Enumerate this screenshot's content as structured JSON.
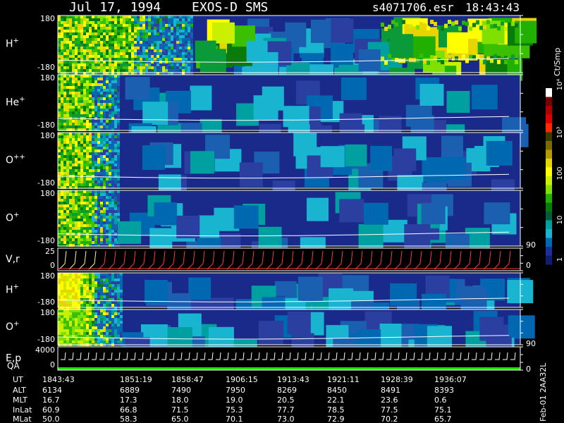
{
  "header": {
    "date": "Jul 17, 1994",
    "instrument": "EXOS-D SMS",
    "file": "s4071706.esr",
    "time": "18:43:43"
  },
  "side_label": "Feb-01 2AA32L",
  "colorbar": {
    "unit": "Ct/Smp",
    "ticks": [
      "1",
      "10",
      "100",
      "10³",
      "10⁴"
    ],
    "colors": [
      "#ffffff",
      "#7a0000",
      "#b00000",
      "#e00000",
      "#ff2a00",
      "#3b3b00",
      "#7a6b00",
      "#b89a00",
      "#e8d400",
      "#ffff00",
      "#c8f000",
      "#80e000",
      "#22b000",
      "#0a7a0a",
      "#005f3a",
      "#00a0a0",
      "#18b4d0",
      "#0068b0",
      "#1a2f9a",
      "#101c70"
    ]
  },
  "panels": [
    {
      "label_base": "H",
      "label_sup": "+",
      "ymax": "180",
      "ymin": "-180"
    },
    {
      "label_base": "He",
      "label_sup": "+",
      "ymax": "180",
      "ymin": "-180"
    },
    {
      "label_base": "O",
      "label_sup": "++",
      "ymax": "180",
      "ymin": "-180"
    },
    {
      "label_base": "O",
      "label_sup": "+",
      "ymax": "180",
      "ymin": "-180",
      "right_tick": "90"
    },
    {
      "label_base": "V,r",
      "label_sup": "",
      "ymax": "25",
      "ymin": "0",
      "right_tick": "0"
    },
    {
      "label_base": "H",
      "label_sup": "+",
      "ymax": "180",
      "ymin": "-180"
    },
    {
      "label_base": "O",
      "label_sup": "+",
      "ymax": "180",
      "ymin": "-180",
      "right_tick": "90"
    },
    {
      "label_base": "E,p",
      "label_sup": "",
      "ymax": "4000",
      "ymin": "0",
      "right_tick": "0"
    }
  ],
  "qa_label": "QA",
  "footer": {
    "rows": [
      {
        "label": "UT",
        "values": [
          "1843:43",
          "1851:19",
          "1858:47",
          "1906:15",
          "1913:43",
          "1921:11",
          "1928:39",
          "1936:07"
        ]
      },
      {
        "label": "ALT",
        "values": [
          "6134",
          "6889",
          "7490",
          "7950",
          "8269",
          "8450",
          "8491",
          "8393"
        ]
      },
      {
        "label": "MLT",
        "values": [
          "16.7",
          "17.3",
          "18.0",
          "19.0",
          "20.5",
          "22.1",
          "23.6",
          "0.6"
        ]
      },
      {
        "label": "InLat",
        "values": [
          "60.9",
          "66.8",
          "71.5",
          "75.3",
          "77.7",
          "78.5",
          "77.5",
          "75.1"
        ]
      },
      {
        "label": "MLat",
        "values": [
          "50.0",
          "58.3",
          "65.0",
          "70.1",
          "73.0",
          "72.9",
          "70.2",
          "65.7"
        ]
      }
    ]
  },
  "chart_data": {
    "type": "heatmap",
    "title": "Jul 17, 1994 EXOS-D SMS",
    "x_tick_labels": [
      "1843:43",
      "1851:19",
      "1858:47",
      "1906:15",
      "1913:43",
      "1921:11",
      "1928:39",
      "1936:07"
    ],
    "angle_range": [
      -180,
      180
    ],
    "colorbar_range": [
      1,
      10000
    ],
    "colorbar_scale": "log",
    "background_color": "#1a2a8a",
    "line_color": "#ffffff"
  }
}
